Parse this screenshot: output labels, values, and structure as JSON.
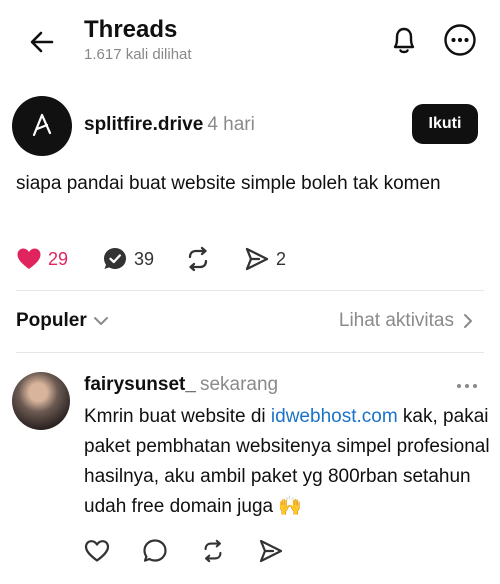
{
  "header": {
    "title": "Threads",
    "subtitle": "1.617 kali dilihat"
  },
  "post": {
    "author": "splitfire.drive",
    "time": "4 hari",
    "follow_label": "Ikuti",
    "text": "siapa pandai buat website simple boleh tak komen",
    "likes": "29",
    "replies": "39",
    "shares": "2",
    "liked": true
  },
  "sort": {
    "label": "Populer",
    "activity_label": "Lihat aktivitas"
  },
  "reply": {
    "author": "fairysunset_",
    "time": "sekarang",
    "text_before": "Kmrin buat website di ",
    "link": "idwebhost.com",
    "text_after": " kak, pakai paket pembhatan websitenya simpel profesional hasilnya, aku ambil paket yg 800rban setahun udah free domain juga 🙌"
  },
  "colors": {
    "like": "#e0245e",
    "link": "#1a73c8",
    "muted": "#8a8a8a",
    "button": "#101010"
  }
}
